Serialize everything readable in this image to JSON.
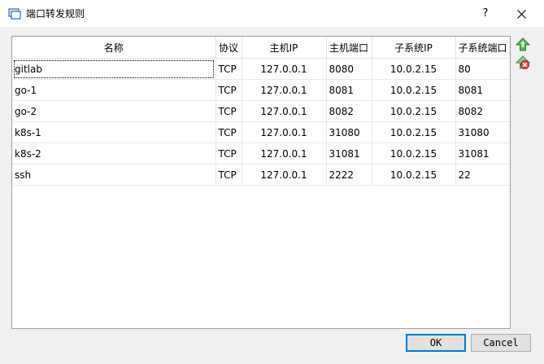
{
  "window": {
    "title": "端口转发规则",
    "help_label": "?",
    "close_icon": "close-icon"
  },
  "table": {
    "columns": [
      "名称",
      "协议",
      "主机IP",
      "主机端口",
      "子系统IP",
      "子系统端口"
    ],
    "rows": [
      [
        "gitlab",
        "TCP",
        "127.0.0.1",
        "8080",
        "10.0.2.15",
        "80"
      ],
      [
        "go-1",
        "TCP",
        "127.0.0.1",
        "8081",
        "10.0.2.15",
        "8081"
      ],
      [
        "go-2",
        "TCP",
        "127.0.0.1",
        "8082",
        "10.0.2.15",
        "8082"
      ],
      [
        "k8s-1",
        "TCP",
        "127.0.0.1",
        "31080",
        "10.0.2.15",
        "31080"
      ],
      [
        "k8s-2",
        "TCP",
        "127.0.0.1",
        "31081",
        "10.0.2.15",
        "31081"
      ],
      [
        "ssh",
        "TCP",
        "127.0.0.1",
        "2222",
        "10.0.2.15",
        "22"
      ]
    ]
  },
  "side_buttons": {
    "add_icon": "add-rule-icon",
    "remove_icon": "remove-rule-icon"
  },
  "footer": {
    "ok_label": "OK",
    "cancel_label": "Cancel"
  }
}
